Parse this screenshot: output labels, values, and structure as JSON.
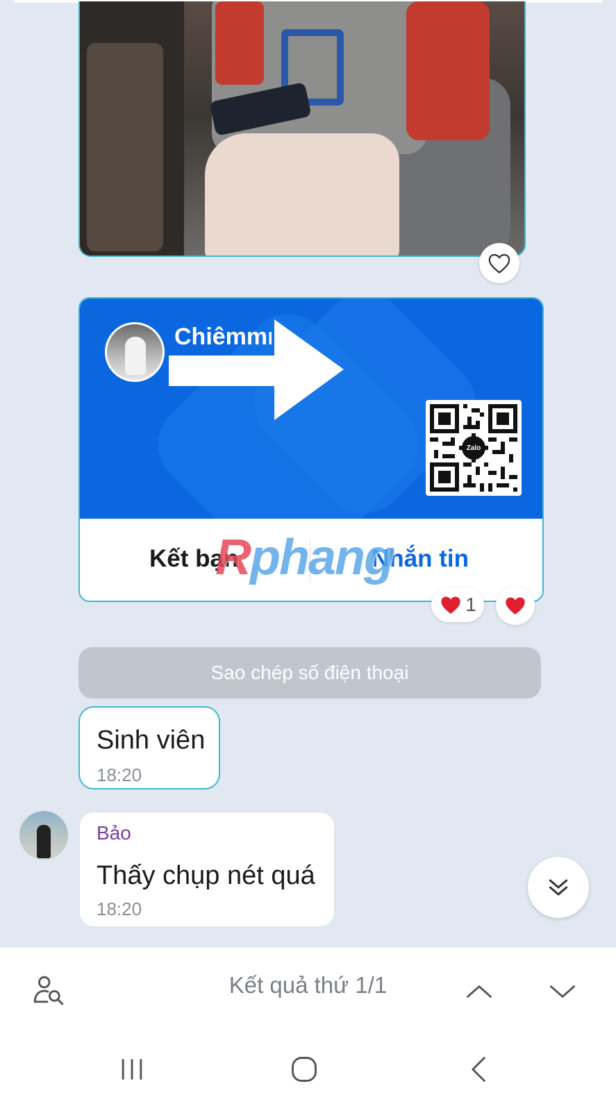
{
  "card": {
    "name": "Chiêmmm",
    "add_friend_label": "Kết bạn",
    "message_label": "Nhắn tin",
    "qr_logo": "Zalo"
  },
  "watermark": {
    "r": "R",
    "rest": "phang"
  },
  "reactions": {
    "heart_count": "1"
  },
  "copy_phone_label": "Sao chép số điện thoại",
  "messages": [
    {
      "text": "Sinh viên",
      "time": "18:20"
    },
    {
      "sender": "Bảo",
      "text": "Thấy chụp nét quá",
      "time": "18:20"
    }
  ],
  "search": {
    "result_text": "Kết quả thứ 1/1"
  },
  "icons": {
    "heart_outline": "heart-outline-icon",
    "heart_filled": "heart-icon",
    "scroll_down": "double-chevron-down-icon",
    "find_member": "person-search-icon",
    "prev": "chevron-up-icon",
    "next": "chevron-down-icon",
    "recents": "recents-icon",
    "home": "home-icon",
    "back": "back-icon"
  },
  "colors": {
    "chat_bg": "#e1e8f1",
    "card_blue": "#0b67e0",
    "bubble_border": "#3fb6cf",
    "sender_purple": "#7a3ea0",
    "heart_red": "#e0202e"
  }
}
